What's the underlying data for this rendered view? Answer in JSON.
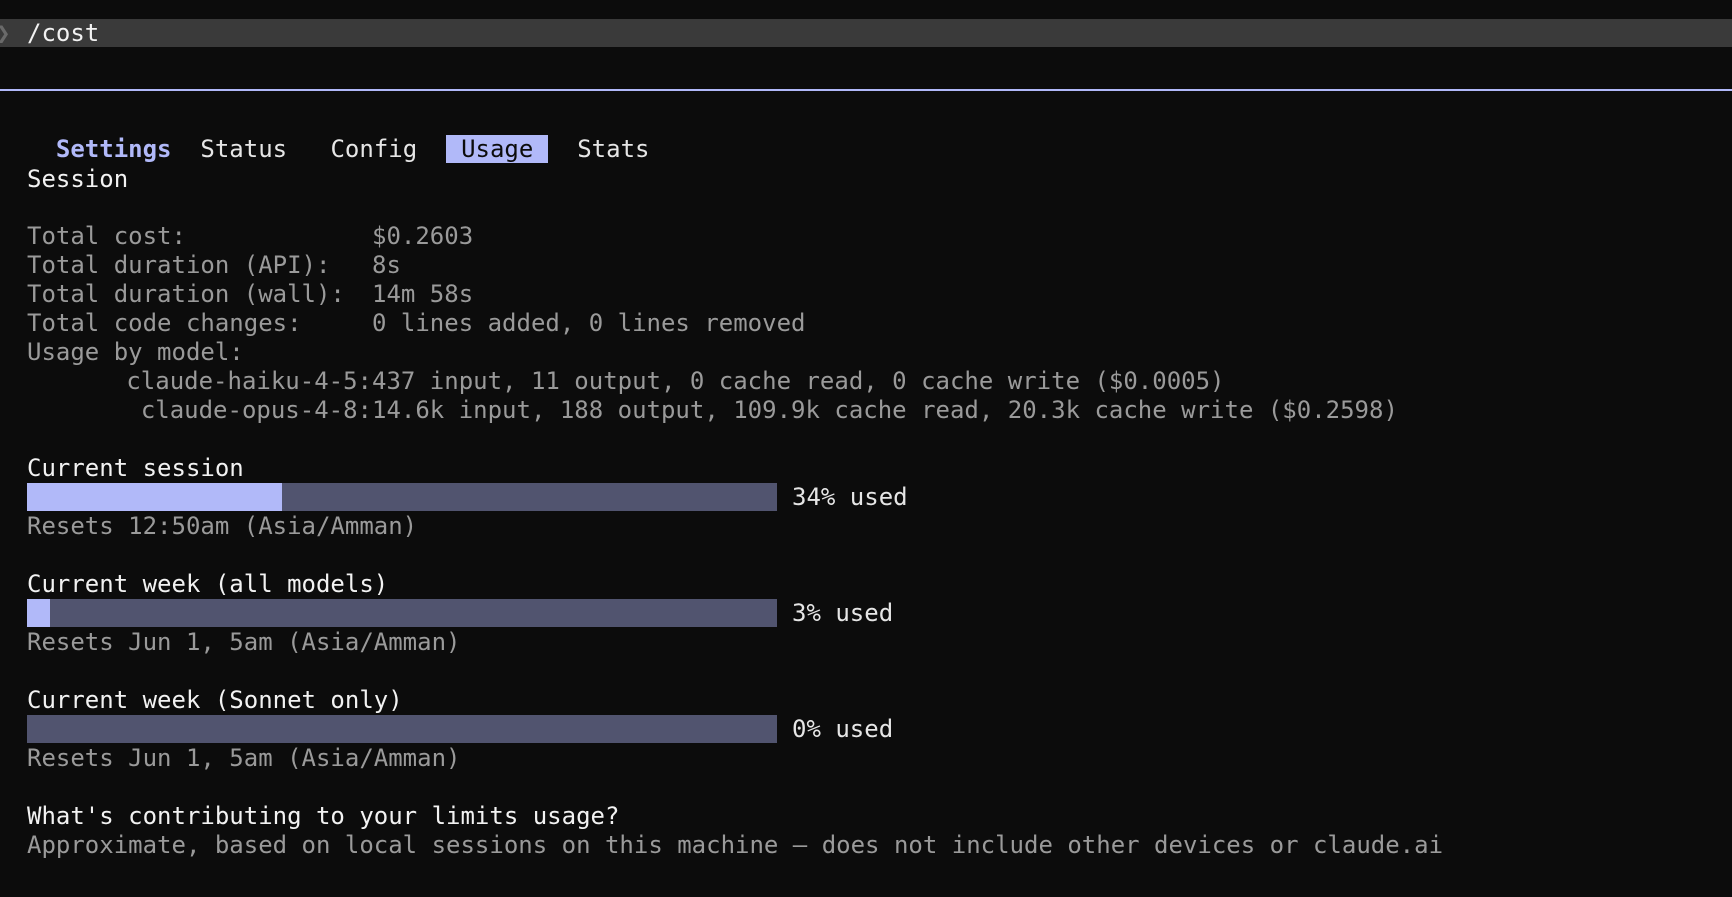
{
  "command": {
    "prompt_glyph": "❯",
    "text": "/cost"
  },
  "tabs": {
    "settings": "Settings",
    "items": [
      "Status",
      "Config",
      "Usage",
      "Stats"
    ],
    "active": "Usage"
  },
  "session": {
    "heading": "Session",
    "rows": [
      {
        "label": "Total cost:",
        "value": "$0.2603"
      },
      {
        "label": "Total duration (API):",
        "value": "8s"
      },
      {
        "label": "Total duration (wall):",
        "value": "14m 58s"
      },
      {
        "label": "Total code changes:",
        "value": "0 lines added, 0 lines removed"
      }
    ],
    "usage_by_model_label": "Usage by model:",
    "models": [
      {
        "name": "claude-haiku-4-5:",
        "value": "437 input, 11 output, 0 cache read, 0 cache write ($0.0005)"
      },
      {
        "name": "claude-opus-4-8:",
        "value": "14.6k input, 188 output, 109.9k cache read, 20.3k cache write ($0.2598)"
      }
    ]
  },
  "limits": [
    {
      "title": "Current session",
      "percent": 34,
      "used_label": "34% used",
      "resets": "Resets 12:50am (Asia/Amman)"
    },
    {
      "title": "Current week (all models)",
      "percent": 3,
      "used_label": "3% used",
      "resets": "Resets Jun 1, 5am (Asia/Amman)"
    },
    {
      "title": "Current week (Sonnet only)",
      "percent": 0,
      "used_label": "0% used",
      "resets": "Resets Jun 1, 5am (Asia/Amman)"
    }
  ],
  "contributing": {
    "heading": "What's contributing to your limits usage?",
    "note": "Approximate, based on local sessions on this machine — does not include other devices or claude.ai"
  },
  "colors": {
    "accent": "#b1b9f9",
    "bar_track": "#51546f",
    "background": "#0c0c0c"
  }
}
